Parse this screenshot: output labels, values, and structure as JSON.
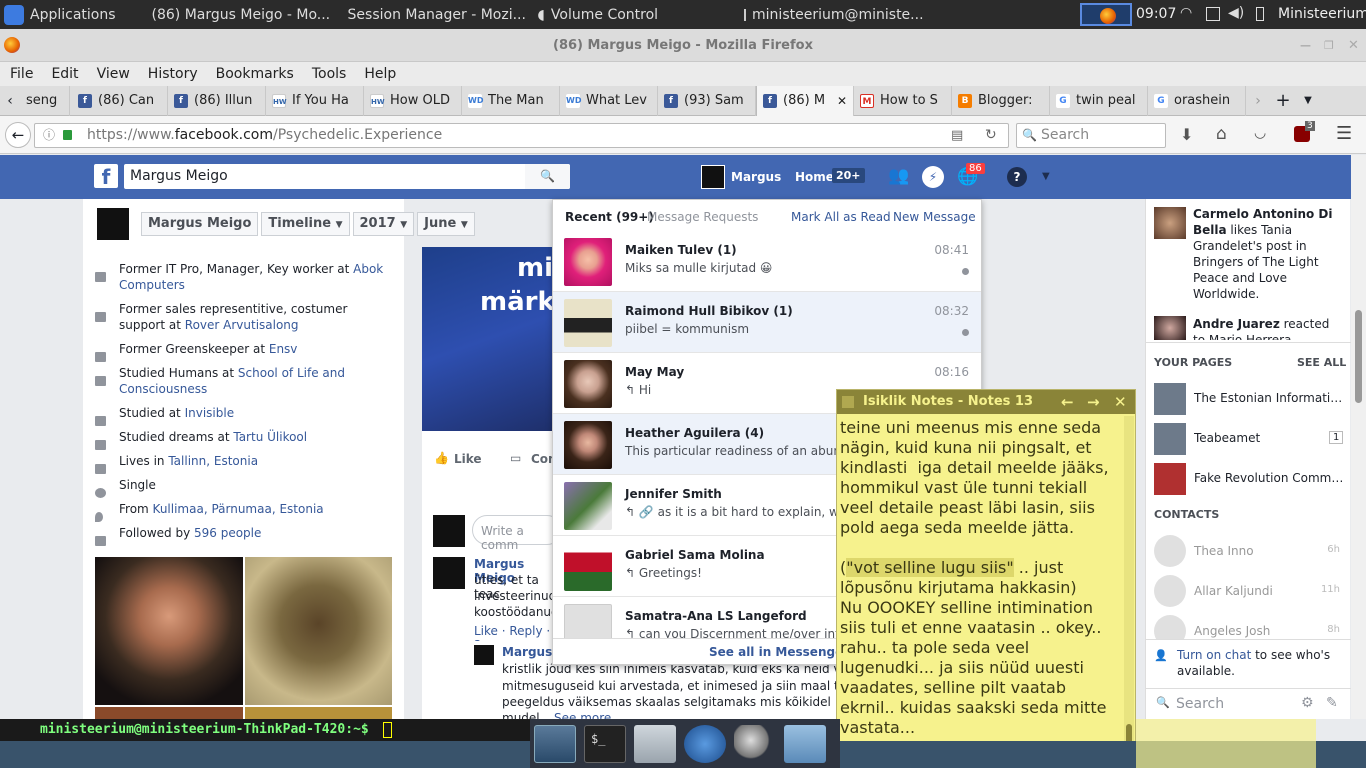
{
  "syspanel": {
    "apps": "Applications",
    "t1": "(86) Margus Meigo - Mo...",
    "t2": "Session Manager - Mozi...",
    "t3": "Volume Control",
    "t4": "ministeerium@ministe...",
    "clock": "09:07",
    "user": "Ministeerium"
  },
  "window_title": "(86) Margus Meigo - Mozilla Firefox",
  "menu": [
    "File",
    "Edit",
    "View",
    "History",
    "Bookmarks",
    "Tools",
    "Help"
  ],
  "tabs": [
    {
      "label": "seng",
      "fav": ""
    },
    {
      "label": "(86) Can",
      "fav": "f"
    },
    {
      "label": "(86) Illun",
      "fav": "f"
    },
    {
      "label": "If You Ha",
      "fav": "HW"
    },
    {
      "label": "How OLD",
      "fav": "HW"
    },
    {
      "label": "The Man",
      "fav": "WD"
    },
    {
      "label": "What Lev",
      "fav": "WD"
    },
    {
      "label": "(93) Sam",
      "fav": "f"
    },
    {
      "label": "(86) M",
      "fav": "f"
    },
    {
      "label": "How to S",
      "fav": "M"
    },
    {
      "label": "Blogger:",
      "fav": "B"
    },
    {
      "label": "twin peal",
      "fav": "G"
    },
    {
      "label": "orashein",
      "fav": "G"
    }
  ],
  "nav": {
    "url_prefix": "https://www.",
    "url_domain": "facebook.com",
    "url_path": "/Psychedelic.Experience",
    "search_placeholder": "Search",
    "ublock_count": "3"
  },
  "fb": {
    "search_value": "Margus Meigo",
    "user": "Margus",
    "home": "Home",
    "home_badge": "20+",
    "notif_badge": "86"
  },
  "timeline": {
    "name": "Margus Meigo",
    "timeline": "Timeline",
    "year": "2017",
    "month": "June"
  },
  "info": [
    {
      "pre": "Former IT Pro, Manager, Key worker at ",
      "link": "Abok Computers"
    },
    {
      "pre": "Former sales representitive, costumer support at ",
      "link": "Rover Arvutisalong"
    },
    {
      "pre": "Former Greenskeeper at ",
      "link": "Ensv"
    },
    {
      "pre": "Studied Humans at ",
      "link": "School of Life and Consciousness"
    },
    {
      "pre": "Studied at ",
      "link": "Invisible"
    },
    {
      "pre": "Studied dreams at ",
      "link": "Tartu Ülikool"
    },
    {
      "pre": "Lives in ",
      "link": "Tallinn, Estonia"
    },
    {
      "pre": "Single",
      "link": ""
    },
    {
      "pre": "From ",
      "link": "Kullimaa, Pärnumaa, Estonia"
    },
    {
      "pre": "Followed by ",
      "link": "596 people"
    }
  ],
  "post": {
    "like": "Like",
    "comment": "Com",
    "write_comment": "Write a comm",
    "commenter": "Margus Meigo",
    "c_text1": "ütles, et ta teac",
    "c_text2": "investeerinud,",
    "c_text3": "koostöödanud",
    "reply_like": "Like · Reply · 2",
    "reply_name": "Margus M",
    "reply_t1": "kristlik jõud kes siin inimeis kasvatab, kuid eks ka neid võib ol",
    "reply_t2": "mitmesuguseid kui arvestada, et inimesed ja siin maal toimuv",
    "reply_t3": "peegeldus väiksemas skaalas selgitamaks mis kõikidel",
    "reply_t4": "mudel",
    "see_more": "See more",
    "banner1": "mi",
    "banner2": "märk"
  },
  "messages": {
    "recent": "Recent (99+)",
    "requests": "Message Requests",
    "mark_all": "Mark All as Read",
    "new_msg": "New Message",
    "see_all": "See all in Messenger",
    "items": [
      {
        "name": "Maiken Tulev (1)",
        "snippet": "Miks sa mulle kirjutad 😀",
        "time": "08:41"
      },
      {
        "name": "Raimond Hull Bibikov (1)",
        "snippet": "piibel = kommunism",
        "time": "08:32"
      },
      {
        "name": "May May",
        "snippet": "↰ Hi",
        "time": "08:16"
      },
      {
        "name": "Heather Aguilera (4)",
        "snippet": "This particular readiness of an abundan",
        "time": ""
      },
      {
        "name": "Jennifer Smith",
        "snippet": "↰ 🔗 as it is a bit hard to explain, whit ou",
        "time": ""
      },
      {
        "name": "Gabriel Sama Molina",
        "snippet": "↰ Greetings!",
        "time": ""
      },
      {
        "name": "Samatra-Ana LS Langeford",
        "snippet": "↰ can you Discernment me/over intern",
        "time": ""
      }
    ]
  },
  "ticker": [
    {
      "actor": "Carmelo Antonino Di Bella",
      "rest": " likes Tania Grandelet's post in Bringers of The Light Peace and Love Worldwide."
    },
    {
      "actor": "Andre Juarez",
      "rest": " reacted to Mario Herrera Azmitia's"
    }
  ],
  "your_pages": {
    "title": "YOUR PAGES",
    "see_all": "SEE ALL",
    "items": [
      {
        "name": "The Estonian Information ...",
        "badge": ""
      },
      {
        "name": "Teabeamet",
        "badge": "1"
      },
      {
        "name": "Fake Revolution Commie...",
        "badge": ""
      }
    ]
  },
  "contacts": {
    "title": "CONTACTS",
    "items": [
      {
        "name": "Thea Inno",
        "time": "6h"
      },
      {
        "name": "Allar Kaljundi",
        "time": "11h"
      },
      {
        "name": "Angeles Josh",
        "time": "8h"
      }
    ],
    "turn_on": "Turn on chat",
    "turn_rest": " to see who's available.",
    "search": "Search"
  },
  "notes": {
    "title": "Isiklik Notes - Notes 13",
    "text_a": "teine uni meenus mis enne seda nägin, kuid kuna nii pingsalt, et kindlasti  iga detail meelde jääks, hommikul vast üle tunni tekiall veel detaile peast läbi lasin, siis pold aega seda meelde jätta.\n\n(",
    "highlight": "\"vot selline lugu siis\"",
    "text_b": " .. just lõpusõnu kirjutama hakkasin)\nNu OOOKEY selline intimination siis tuli et enne vaatasin .. okey.. rahu.. ta pole seda veel lugenudki... ja siis nüüd uuesti vaadates, selline pilt vaatab ekrnil.. kuidas saakski seda mitte vastata..."
  },
  "terminal": {
    "prompt": "ministeerium@ministeerium-ThinkPad-T420:~$"
  }
}
